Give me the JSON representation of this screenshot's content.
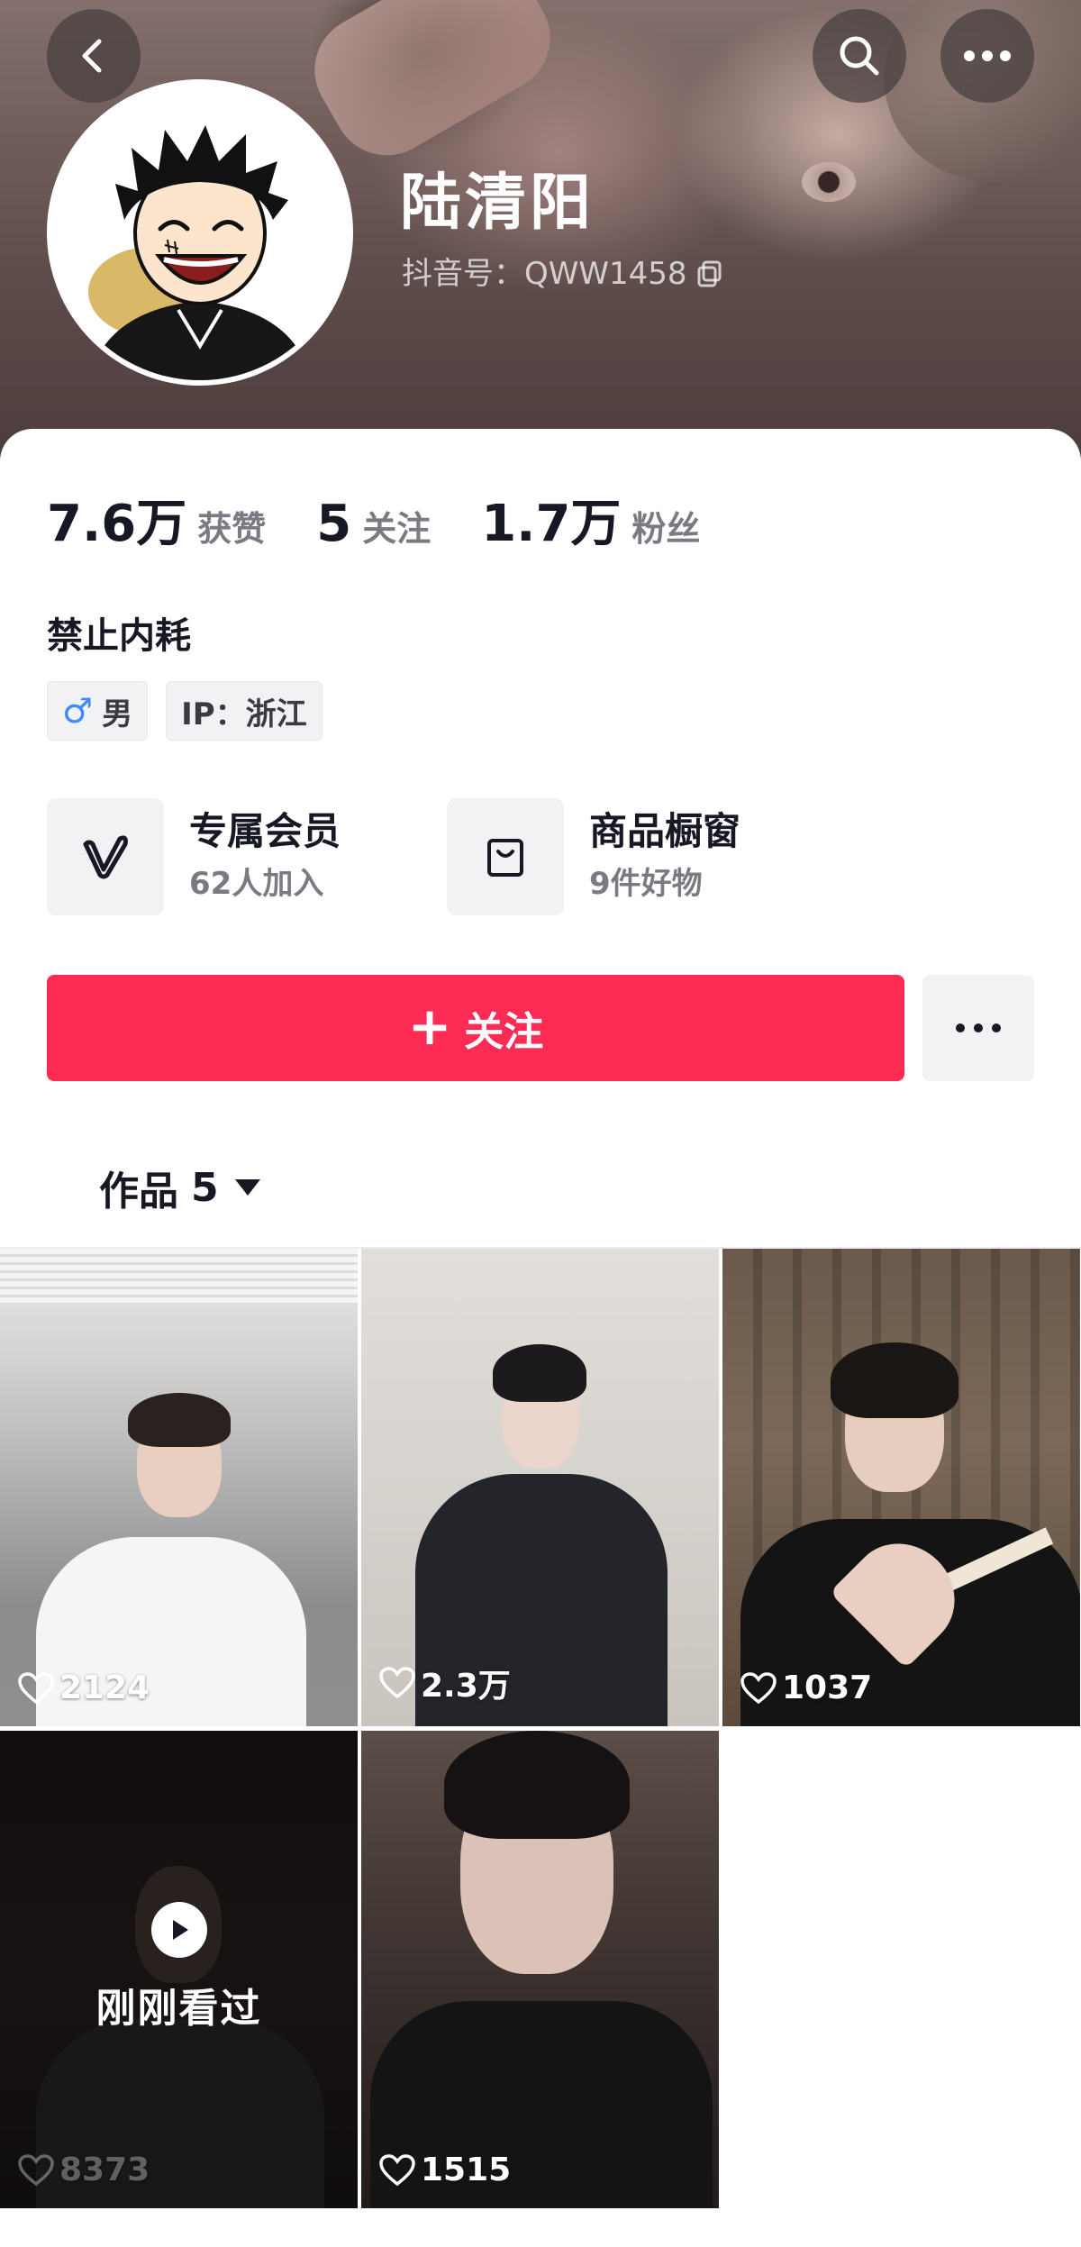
{
  "header": {
    "nickname": "陆清阳",
    "douyin_id": "抖音号：QWW1458"
  },
  "stats": [
    {
      "value": "7.6万",
      "label": "获赞"
    },
    {
      "value": "5",
      "label": "关注"
    },
    {
      "value": "1.7万",
      "label": "粉丝"
    }
  ],
  "bio": "禁止内耗",
  "tags": {
    "gender_symbol": "♂",
    "gender": "男",
    "ip": "IP：浙江"
  },
  "features": [
    {
      "title": "专属会员",
      "subtitle": "62人加入",
      "icon": "vip-v-icon"
    },
    {
      "title": "商品橱窗",
      "subtitle": "9件好物",
      "icon": "shopping-bag-icon"
    }
  ],
  "actions": {
    "follow_label": "关注",
    "follow_plus": "+"
  },
  "works_tab": {
    "label": "作品",
    "count": "5"
  },
  "videos": [
    {
      "likes": "2124"
    },
    {
      "likes": "2.3万"
    },
    {
      "likes": "1037"
    },
    {
      "likes": "8373",
      "watched_label": "刚刚看过"
    },
    {
      "likes": "1515"
    }
  ],
  "colors": {
    "follow_button": "#fe2c55",
    "accent_male": "#3d8bff",
    "text_primary": "#161823",
    "text_secondary": "#7a7b82"
  }
}
